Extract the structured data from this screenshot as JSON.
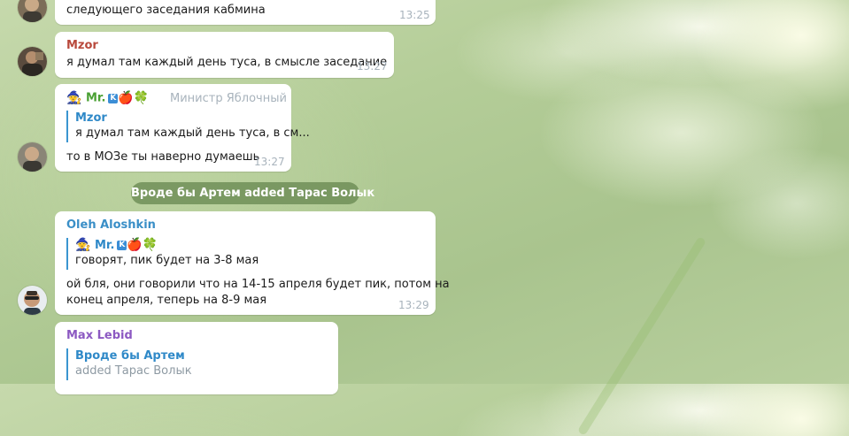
{
  "messages": {
    "m1": {
      "text": "следующего заседания кабмина",
      "time": "13:25"
    },
    "m2": {
      "sender": "Mzor",
      "text": "я думал там каждый день туса, в смысле заседание",
      "time": "13:27"
    },
    "m3": {
      "sender": "Mr.",
      "sender_badge": "K",
      "sender_emojis": "🍎🍀",
      "sender_prefix_emoji": "🧙",
      "title": "Министр Яблочный",
      "reply_name": "Mzor",
      "reply_text": "я думал там каждый день туса, в см...",
      "text": "то в МОЗе ты наверно думаешь",
      "time": "13:27"
    },
    "service": {
      "text": "Вроде бы Артем added Тарас Волык"
    },
    "m4": {
      "sender": "Oleh Aloshkin",
      "reply_name": "Mr.",
      "reply_badge": "K",
      "reply_emojis": "🍎🍀",
      "reply_prefix_emoji": "🧙",
      "reply_text": "говорят, пик будет на 3-8 мая",
      "text_line1": "ой бля, они говорили что на 14-15 апреля будет пик, потом на",
      "text_line2": "конец апреля, теперь на 8-9 мая",
      "time": "13:29"
    },
    "m5": {
      "sender": "Max Lebid",
      "reply_name": "Вроде бы Артем",
      "reply_text": "added Тарас Волык"
    }
  },
  "colors": {
    "mzor": "#b8493c",
    "mr": "#4aa033",
    "oleh": "#3a8fc7",
    "max": "#8c59c2",
    "quote_bar": "#3a95d0",
    "time": "#a8b3bc"
  }
}
